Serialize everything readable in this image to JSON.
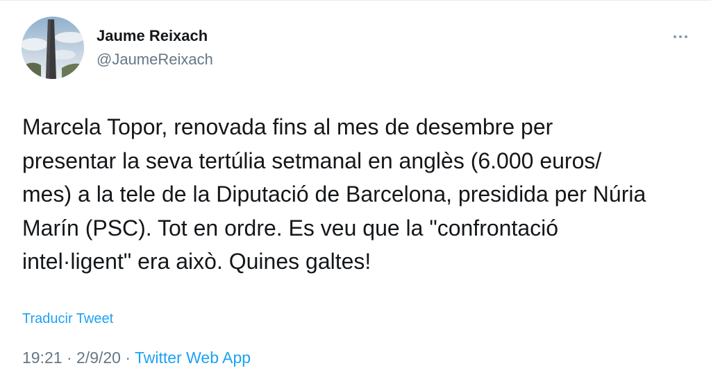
{
  "author": {
    "name": "Jaume Reixach",
    "handle": "@JaumeReixach",
    "avatar_icon": "chimney-tower-avatar-icon"
  },
  "menu": {
    "icon": "more-dots-icon"
  },
  "tweet": {
    "text": "Marcela Topor, renovada fins al mes de desembre per\npresentar la seva tertúlia setmanal en anglès (6.000 euros/\nmes) a la tele de la Diputació de Barcelona, presidida per Núria\nMarín (PSC). Tot en ordre. Es veu que la \"confrontació\nintel·ligent\" era això. Quines galtes!",
    "translate_label": "Traducir Tweet",
    "time": "19:21",
    "date": "2/9/20",
    "separator": "·",
    "source": "Twitter Web App"
  },
  "colors": {
    "link": "#1da1f2",
    "secondary_text": "#657786",
    "primary_text": "#14171a"
  }
}
